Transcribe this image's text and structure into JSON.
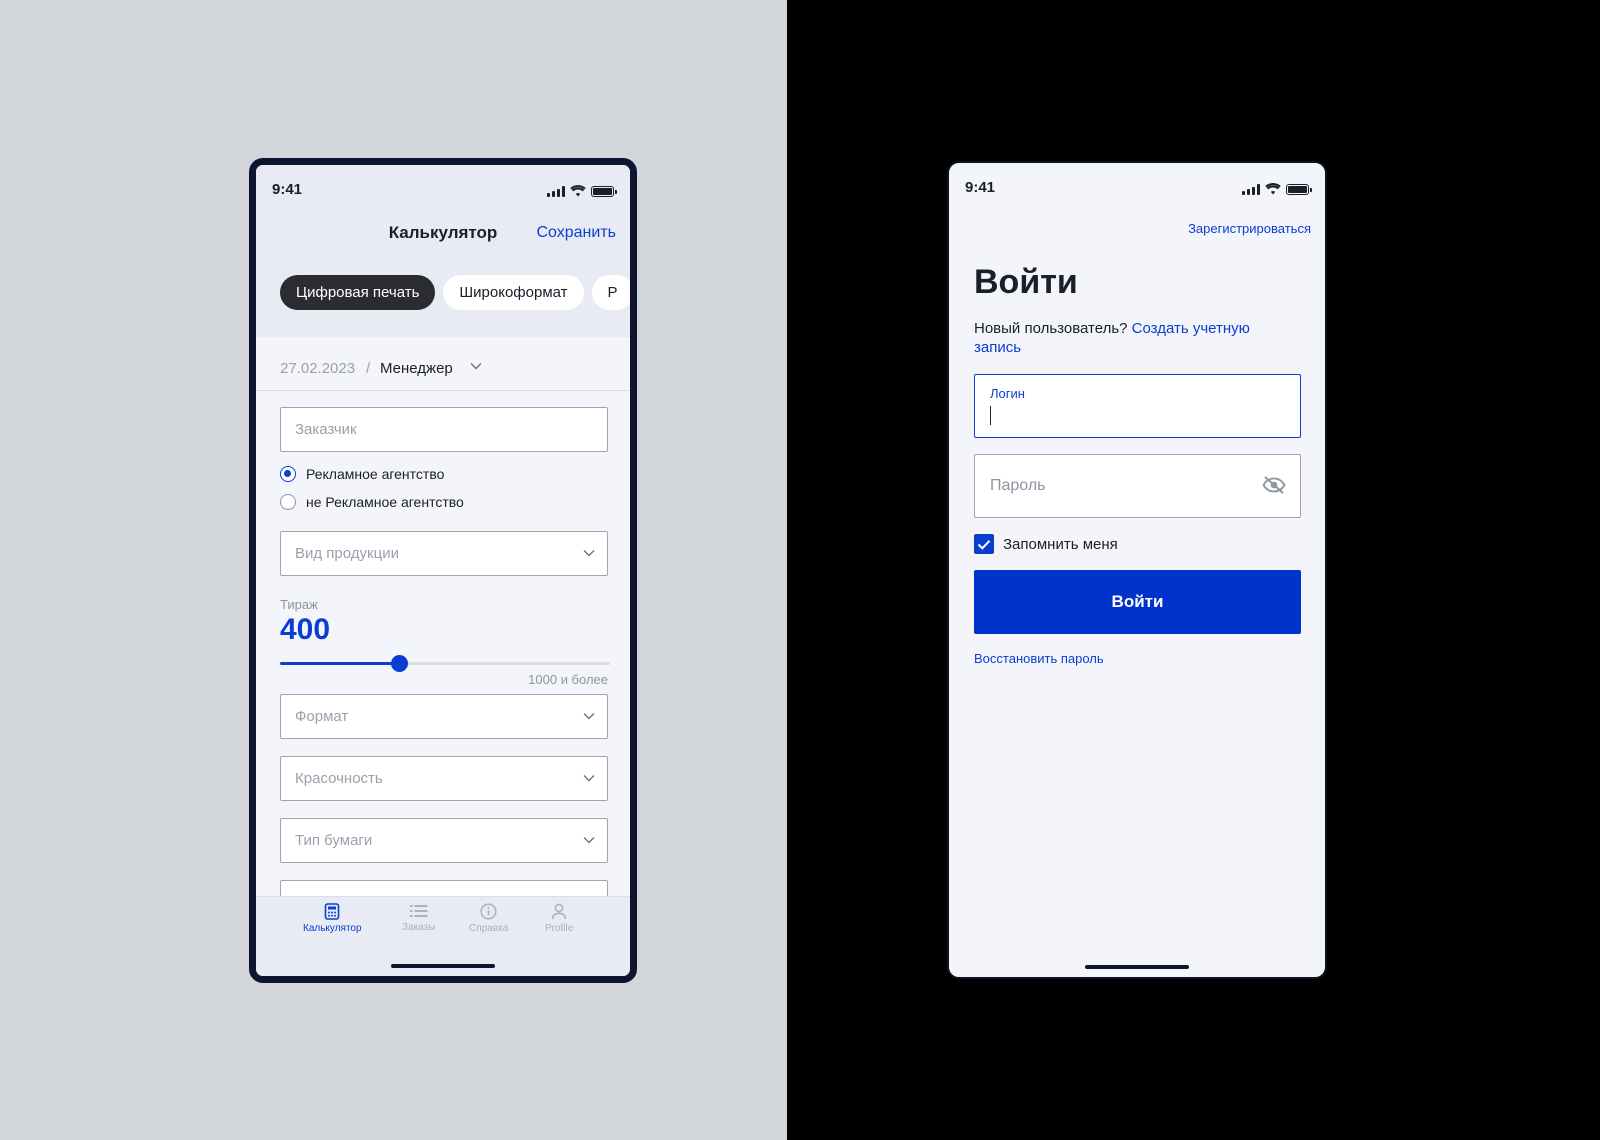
{
  "colors": {
    "accent": "#0a3ed1",
    "primary_button": "#0033cc",
    "dark_chip": "#2a2c30",
    "left_bg": "#d2d6db",
    "right_bg": "#000000"
  },
  "left_phone": {
    "status": {
      "time": "9:41"
    },
    "header": {
      "title": "Калькулятор",
      "save_label": "Сохранить"
    },
    "chips": [
      "Цифровая печать",
      "Широкоформат",
      "Р"
    ],
    "active_chip": 0,
    "meta": {
      "date": "27.02.2023",
      "separator": "/",
      "manager": "Менеджер"
    },
    "customer_placeholder": "Заказчик",
    "radios": [
      {
        "label": "Рекламное агентство",
        "checked": true
      },
      {
        "label": "не Рекламное агентство",
        "checked": false
      }
    ],
    "product_type_placeholder": "Вид продукции",
    "circulation": {
      "label": "Тираж",
      "value": "400",
      "max_label": "1000 и более",
      "fraction": 0.36
    },
    "format_placeholder": "Формат",
    "color_placeholder": "Красочность",
    "paper_placeholder": "Тип бумаги",
    "tabs": [
      {
        "label": "Калькулятор",
        "icon": "calculator-icon",
        "active": true
      },
      {
        "label": "Заказы",
        "icon": "list-icon",
        "active": false
      },
      {
        "label": "Справка",
        "icon": "info-icon",
        "active": false
      },
      {
        "label": "Profile",
        "icon": "user-icon",
        "active": false
      }
    ]
  },
  "right_phone": {
    "status": {
      "time": "9:41"
    },
    "register_link": "Зарегистрироваться",
    "title": "Войти",
    "new_user_text": "Новый пользователь?",
    "create_account_link": "Создать учетную запись",
    "login_label": "Логин",
    "password_placeholder": "Пароль",
    "remember_me": {
      "label": "Запомнить меня",
      "checked": true
    },
    "submit_label": "Войти",
    "restore_link": "Восстановить пароль"
  }
}
